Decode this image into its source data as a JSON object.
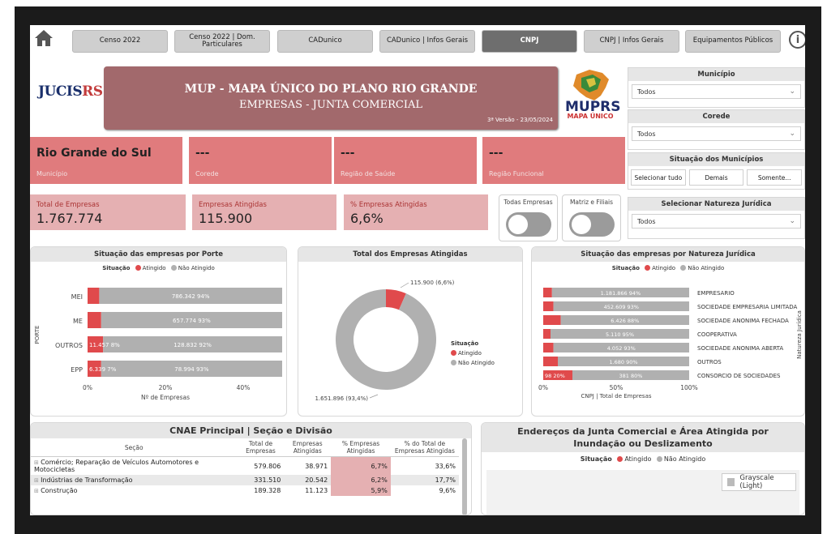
{
  "nav": {
    "tabs": [
      {
        "label": "Censo 2022"
      },
      {
        "label": "Censo 2022 | Dom. Particulares"
      },
      {
        "label": "CADunico"
      },
      {
        "label": "CADunico | Infos Gerais"
      },
      {
        "label": "CNPJ"
      },
      {
        "label": "CNPJ | Infos Gerais"
      },
      {
        "label": "Equipamentos Públicos"
      }
    ],
    "info_label": "i"
  },
  "header": {
    "logo_part1": "JUCIS",
    "logo_part2": "RS",
    "title": "MUP - MAPA ÚNICO DO PLANO RIO GRANDE",
    "subtitle": "EMPRESAS - JUNTA COMERCIAL",
    "version": "3ª Versão - 23/05/2024",
    "mup_logo": "MUPRS",
    "mup_logo_sub": "MAPA ÚNICO"
  },
  "filters": {
    "municipio": {
      "label": "Município",
      "value": "Todos"
    },
    "corede": {
      "label": "Corede",
      "value": "Todos"
    },
    "situacao": {
      "label": "Situação dos Municípios",
      "buttons": [
        "Selecionar tudo",
        "Demais",
        "Somente..."
      ]
    },
    "natureza": {
      "label": "Selecionar Natureza Jurídica",
      "value": "Todos"
    }
  },
  "cards": [
    {
      "value": "Rio Grande do Sul",
      "label": "Município"
    },
    {
      "value": "---",
      "label": "Corede"
    },
    {
      "value": "---",
      "label": "Região de Saúde"
    },
    {
      "value": "---",
      "label": "Região Funcional"
    }
  ],
  "kpis": [
    {
      "label": "Total de Empresas",
      "value": "1.767.774"
    },
    {
      "label": "Empresas Atingidas",
      "value": "115.900"
    },
    {
      "label": "% Empresas Atingidas",
      "value": "6,6%"
    }
  ],
  "toggles": [
    {
      "label": "Todas Empresas"
    },
    {
      "label": "Matriz e Filiais"
    }
  ],
  "colors": {
    "atingido": "#e04a4c",
    "nao_atingido": "#b0b0b0",
    "accent": "#e07b7d"
  },
  "chart_porte": {
    "title": "Situação das empresas por Porte",
    "legend_title": "Situação",
    "legend": [
      "Atingido",
      "Não Atingido"
    ],
    "ylabel": "PORTE",
    "xlabel": "Nº de Empresas",
    "ticks": [
      "0%",
      "20%",
      "40%"
    ]
  },
  "chart_donut": {
    "title": "Total dos Empresas Atingidas",
    "legend_title": "Situação",
    "legend": [
      "Atingido",
      "Não Atingido"
    ],
    "label_atingido": "115.900 (6,6%)",
    "label_nao": "1.651.896 (93,4%)"
  },
  "chart_natureza": {
    "title": "Situação das empresas por Natureza Jurídica",
    "legend_title": "Situação",
    "legend": [
      "Atingido",
      "Não Atingido"
    ],
    "ylabel": "Natureza Jurídica",
    "xlabel": "CNPJ | Total de Empresas",
    "ticks": [
      "0%",
      "50%",
      "100%"
    ]
  },
  "chart_data": [
    {
      "type": "bar",
      "title": "Situação das empresas por Porte",
      "categories": [
        "MEI",
        "ME",
        "OUTROS",
        "EPP"
      ],
      "series": [
        {
          "name": "Atingido",
          "values": [
            null,
            null,
            11457,
            6339
          ],
          "percent": [
            null,
            null,
            8,
            7
          ]
        },
        {
          "name": "Não Atingido",
          "values": [
            786342,
            657774,
            128832,
            78994
          ],
          "percent": [
            94,
            93,
            92,
            93
          ]
        }
      ],
      "data_labels": {
        "atingido": [
          "",
          "",
          "11.457 8%",
          "6.339 7%"
        ],
        "nao_atingido": [
          "786.342 94%",
          "657.774 93%",
          "128.832 92%",
          "78.994 93%"
        ]
      },
      "xlabel": "Nº de Empresas",
      "ylabel": "PORTE"
    },
    {
      "type": "pie",
      "title": "Total dos Empresas Atingidas",
      "categories": [
        "Atingido",
        "Não Atingido"
      ],
      "values": [
        115900,
        1651896
      ],
      "percent": [
        6.6,
        93.4
      ]
    },
    {
      "type": "bar",
      "title": "Situação das empresas por Natureza Jurídica",
      "categories": [
        "EMPRESARIO",
        "SOCIEDADE EMPRESARIA LIMITADA",
        "SOCIEDADE ANONIMA FECHADA",
        "COOPERATIVA",
        "SOCIEDADE ANONIMA ABERTA",
        "OUTROS",
        "CONSORCIO DE SOCIEDADES"
      ],
      "series": [
        {
          "name": "Atingido",
          "percent": [
            6,
            7,
            12,
            5,
            7,
            10,
            20
          ],
          "values": [
            null,
            null,
            null,
            null,
            null,
            null,
            98
          ]
        },
        {
          "name": "Não Atingido",
          "percent": [
            94,
            93,
            88,
            95,
            93,
            90,
            80
          ],
          "values": [
            1181866,
            452609,
            6426,
            5110,
            4052,
            1680,
            381
          ]
        }
      ],
      "data_labels": {
        "atingido": [
          "",
          "",
          "",
          "",
          "",
          "",
          "98 20%"
        ],
        "nao_atingido": [
          "1.181.866 94%",
          "452.609 93%",
          "6.426 88%",
          "5.110 95%",
          "4.052 93%",
          "1.680 90%",
          "381 80%"
        ]
      },
      "xlabel": "CNPJ | Total de Empresas",
      "ylabel": "Natureza Jurídica"
    }
  ],
  "cnae": {
    "title": "CNAE Principal | Seção e Divisão",
    "columns": [
      "Seção",
      "Total de Empresas",
      "Empresas Atingidas",
      "% Empresas Atingidas",
      "% do Total de Empresas Atingidas"
    ],
    "rows": [
      {
        "secao": "Comércio; Reparação de Veículos Automotores e Motocicletas",
        "total": "579.806",
        "atingidas": "38.971",
        "pct": "6,7%",
        "pct_total": "33,6%"
      },
      {
        "secao": "Indústrias de Transformação",
        "total": "331.510",
        "atingidas": "20.542",
        "pct": "6,2%",
        "pct_total": "17,7%"
      },
      {
        "secao": "Construção",
        "total": "189.328",
        "atingidas": "11.123",
        "pct": "5,9%",
        "pct_total": "9,6%"
      }
    ]
  },
  "map": {
    "title": "Endereços da Junta Comercial e Área Atingida por Inundação ou Deslizamento",
    "legend_title": "Situação",
    "legend": [
      "Atingido",
      "Não Atingido"
    ],
    "basemap_button": "Grayscale (Light)"
  }
}
